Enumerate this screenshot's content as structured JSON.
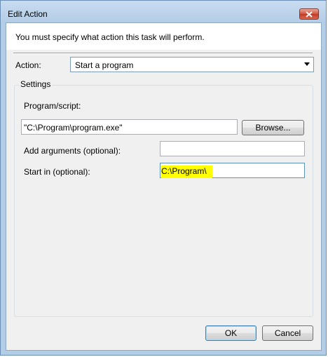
{
  "window": {
    "title": "Edit Action"
  },
  "message": "You must specify what action this task will perform.",
  "action": {
    "label": "Action:",
    "selected": "Start a program"
  },
  "settings": {
    "group_label": "Settings",
    "program_label": "Program/script:",
    "program_value": "\"C:\\Program\\program.exe\"",
    "browse_label": "Browse...",
    "arguments_label": "Add arguments (optional):",
    "arguments_value": "",
    "start_in_label": "Start in (optional):",
    "start_in_value": "C:\\Program\\"
  },
  "buttons": {
    "ok": "OK",
    "cancel": "Cancel"
  },
  "colors": {
    "highlight": "#ffff00",
    "close_button": "#c13a27"
  }
}
